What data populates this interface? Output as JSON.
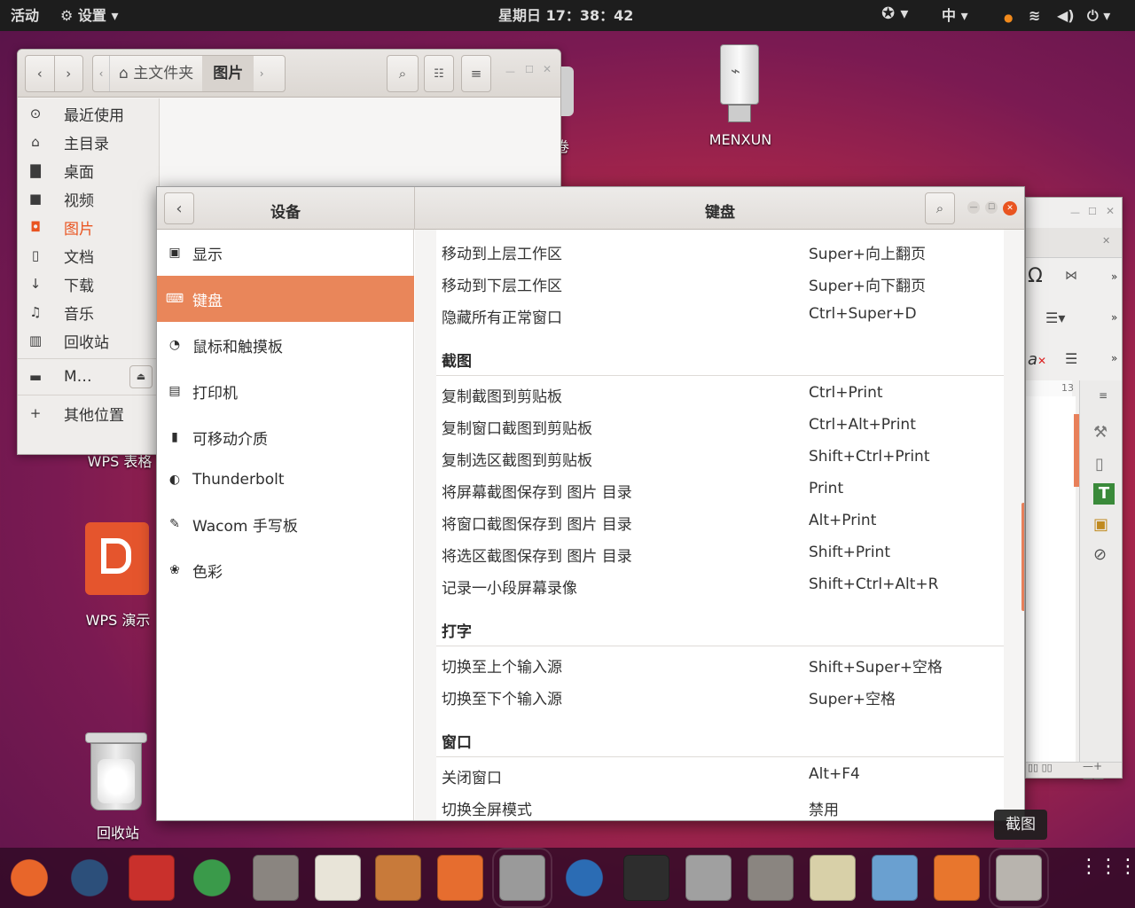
{
  "topbar": {
    "activities": "活动",
    "settings_menu": "设置",
    "clock": "星期日 17：38：42",
    "input_method": "中"
  },
  "desktop": {
    "usb_label": "MENXUN",
    "wps_sheet_label": "WPS 表格",
    "wps_present_label": "WPS 演示",
    "trash_label": "回收站",
    "partial_label": "卷"
  },
  "files": {
    "path": [
      "主文件夹",
      "图片"
    ],
    "sidebar": [
      {
        "icon": "clock-icon",
        "glyph": "⊙",
        "label": "最近使用"
      },
      {
        "icon": "home-icon",
        "glyph": "⌂",
        "label": "主目录"
      },
      {
        "icon": "folder-icon",
        "glyph": "▇",
        "label": "桌面"
      },
      {
        "icon": "video-icon",
        "glyph": "■",
        "label": "视频"
      },
      {
        "icon": "camera-icon",
        "glyph": "◘",
        "label": "图片"
      },
      {
        "icon": "document-icon",
        "glyph": "▯",
        "label": "文档"
      },
      {
        "icon": "download-icon",
        "glyph": "↓",
        "label": "下载"
      },
      {
        "icon": "music-icon",
        "glyph": "♫",
        "label": "音乐"
      },
      {
        "icon": "trash-icon",
        "glyph": "▥",
        "label": "回收站"
      },
      {
        "icon": "drive-icon",
        "glyph": "▬",
        "label": "M…"
      },
      {
        "icon": "plus-icon",
        "glyph": "+",
        "label": "其他位置"
      }
    ]
  },
  "settings": {
    "left_title": "设备",
    "right_title": "键盘",
    "nav": [
      {
        "icon": "display-icon",
        "glyph": "▣",
        "label": "显示"
      },
      {
        "icon": "keyboard-icon",
        "glyph": "⌨",
        "label": "键盘"
      },
      {
        "icon": "mouse-icon",
        "glyph": "◔",
        "label": "鼠标和触摸板"
      },
      {
        "icon": "printer-icon",
        "glyph": "▤",
        "label": "打印机"
      },
      {
        "icon": "removable-media-icon",
        "glyph": "▮",
        "label": "可移动介质"
      },
      {
        "icon": "thunderbolt-icon",
        "glyph": "◐",
        "label": "Thunderbolt"
      },
      {
        "icon": "wacom-icon",
        "glyph": "✎",
        "label": "Wacom 手写板"
      },
      {
        "icon": "color-icon",
        "glyph": "❀",
        "label": "色彩"
      }
    ],
    "top_rows": [
      {
        "name": "移动到上层工作区",
        "key": "Super+向上翻页"
      },
      {
        "name": "移动到下层工作区",
        "key": "Super+向下翻页"
      },
      {
        "name": "隐藏所有正常窗口",
        "key": "Ctrl+Super+D"
      }
    ],
    "screenshot_title": "截图",
    "screenshot_rows": [
      {
        "name": "复制截图到剪贴板",
        "key": "Ctrl+Print"
      },
      {
        "name": "复制窗口截图到剪贴板",
        "key": "Ctrl+Alt+Print"
      },
      {
        "name": "复制选区截图到剪贴板",
        "key": "Shift+Ctrl+Print"
      },
      {
        "name": "将屏幕截图保存到 图片 目录",
        "key": "Print"
      },
      {
        "name": "将窗口截图保存到 图片 目录",
        "key": "Alt+Print"
      },
      {
        "name": "将选区截图保存到 图片 目录",
        "key": "Shift+Print"
      },
      {
        "name": "记录一小段屏幕录像",
        "key": "Shift+Ctrl+Alt+R"
      }
    ],
    "typing_title": "打字",
    "typing_rows": [
      {
        "name": "切换至上个输入源",
        "key": "Shift+Super+空格"
      },
      {
        "name": "切换至下个输入源",
        "key": "Super+空格"
      }
    ],
    "window_title": "窗口",
    "window_rows": [
      {
        "name": "关闭窗口",
        "key": "Alt+F4"
      },
      {
        "name": "切换全屏模式",
        "key": "禁用"
      }
    ]
  },
  "writer": {
    "ruler_num": "13",
    "omega": "Ω"
  },
  "tooltip": "截图",
  "dock": [
    {
      "name": "firefox-icon",
      "color": "#e8662a"
    },
    {
      "name": "network-globe-icon",
      "color": "#2c4f7a"
    },
    {
      "name": "dc-app-icon",
      "color": "#c9302c"
    },
    {
      "name": "chrome-icon",
      "color": "#3a9a4a"
    },
    {
      "name": "files-cabinet-icon",
      "color": "#8a8580"
    },
    {
      "name": "text-editor-icon",
      "color": "#e8e4d8"
    },
    {
      "name": "paint-brush-icon",
      "color": "#c87a3a"
    },
    {
      "name": "calculator-icon",
      "color": "#e66d2f"
    },
    {
      "name": "settings-gear-icon",
      "color": "#9a9a9a"
    },
    {
      "name": "thunderbird-icon",
      "color": "#2b6cb4"
    },
    {
      "name": "terminal-icon",
      "color": "#2d2d2d"
    },
    {
      "name": "image-viewer-icon",
      "color": "#a0a0a0"
    },
    {
      "name": "files-icon",
      "color": "#8a8580"
    },
    {
      "name": "speaker-icon",
      "color": "#d8d0a8"
    },
    {
      "name": "document-viewer-icon",
      "color": "#6aa0d0"
    },
    {
      "name": "software-center-icon",
      "color": "#e8762d"
    },
    {
      "name": "screenshot-camera-icon",
      "color": "#b8b4ae"
    },
    {
      "name": "app-grid-icon",
      "color": "#ffffff"
    }
  ]
}
